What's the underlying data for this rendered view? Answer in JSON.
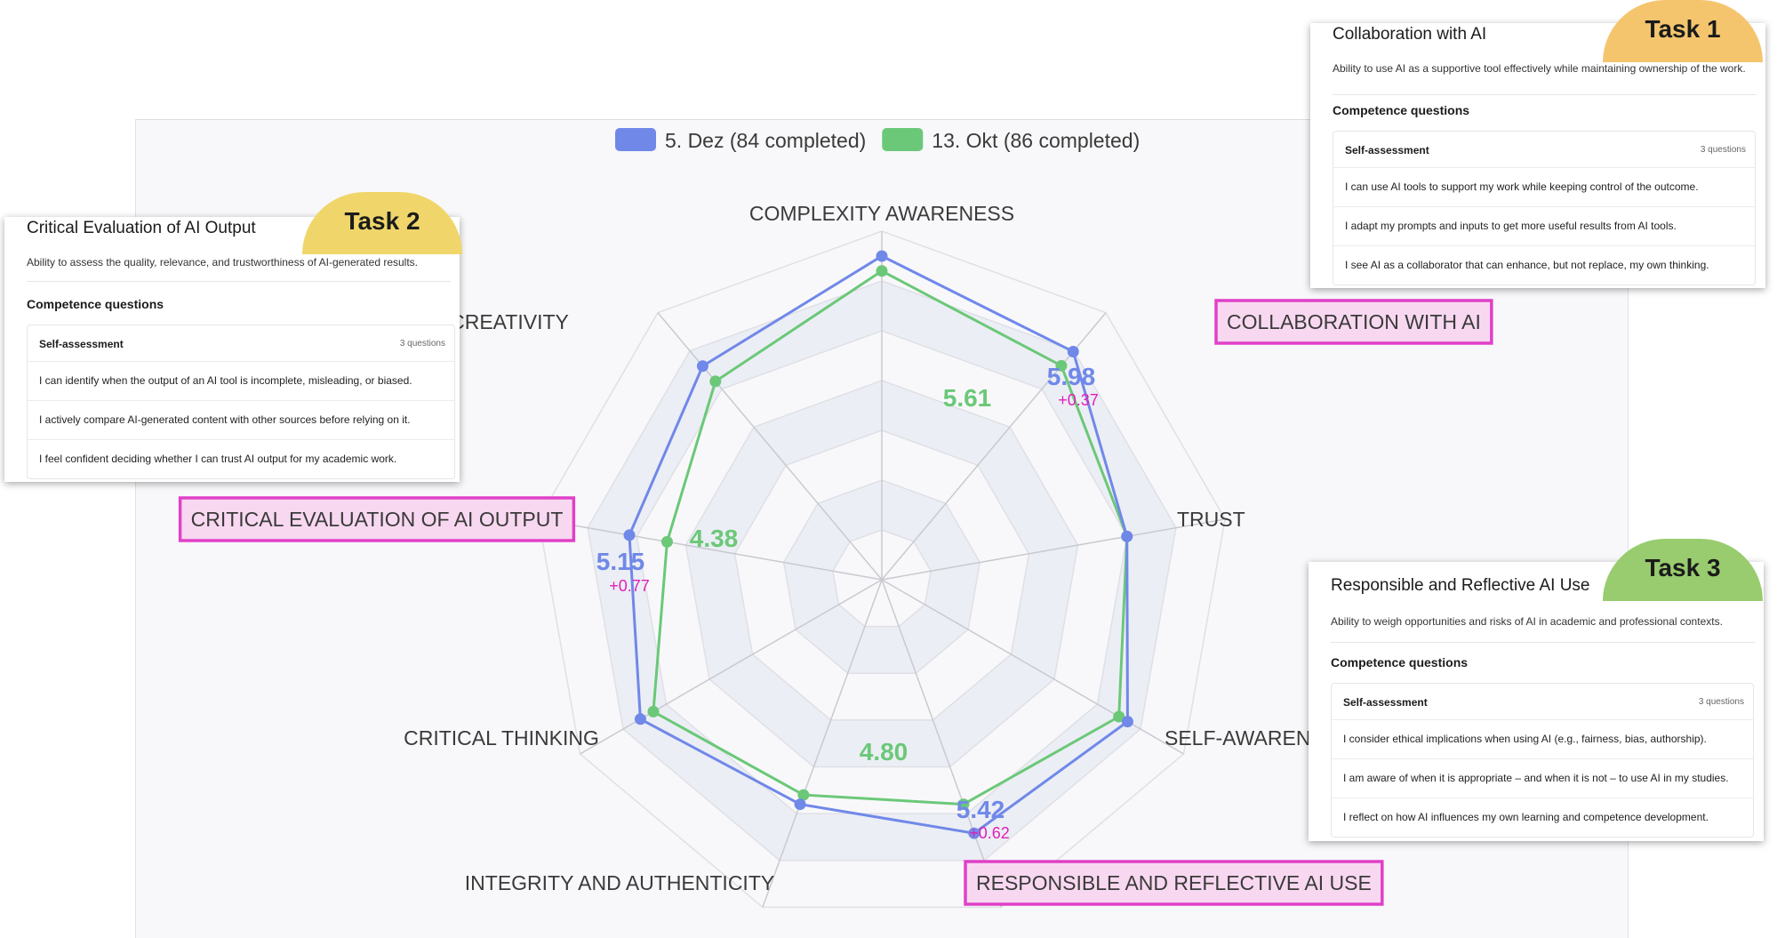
{
  "chart_data": {
    "type": "radar",
    "axes": [
      "COMPLEXITY AWARENESS",
      "COLLABORATION WITH AI",
      "TRUST",
      "SELF-AWARENESS",
      "RESPONSIBLE AND REFLECTIVE AI USE",
      "INTEGRITY AND AUTHENTICITY",
      "CRITICAL THINKING",
      "CRITICAL EVALUATION OF AI OUTPUT",
      "CREATIVITY"
    ],
    "axis_labels_displayed": [
      "COMPLEXITY AWARENESS",
      "COLLABORATION WITH AI",
      "TRUST",
      "SELF-AWARENE",
      "RESPONSIBLE AND REFLECTIVE AI USE",
      "INTEGRITY AND AUTHENTICITY",
      "CRITICAL THINKING",
      "CRITICAL EVALUATION OF AI OUTPUT",
      "CREATIVITY"
    ],
    "rlim": [
      0,
      7
    ],
    "series": [
      {
        "name": "5. Dez (84 completed)",
        "color": "#7088e8",
        "values": [
          6.5,
          5.98,
          5.0,
          5.7,
          5.42,
          4.8,
          5.6,
          5.15,
          5.6
        ]
      },
      {
        "name": "13. Okt (86 completed)",
        "color": "#6bc878",
        "values": [
          6.2,
          5.61,
          5.0,
          5.5,
          4.8,
          4.6,
          5.3,
          4.38,
          5.2
        ]
      }
    ],
    "highlighted": [
      {
        "axis": "COLLABORATION WITH AI",
        "new_label": "5.98",
        "old_label": "5.61",
        "delta": "+0.37"
      },
      {
        "axis": "CRITICAL EVALUATION OF AI OUTPUT",
        "new_label": "5.15",
        "old_label": "4.38",
        "delta": "+0.77"
      },
      {
        "axis": "RESPONSIBLE AND REFLECTIVE AI USE",
        "new_label": "5.42",
        "old_label": "4.80",
        "delta": "+0.62"
      }
    ],
    "legend_position": "top-center",
    "grid": true
  },
  "colors": {
    "new_series": "#7088e8",
    "old_series": "#6bc878",
    "highlight_border": "#e040c8",
    "highlight_fill": "#f8d8f0",
    "delta_text": "#e020b8",
    "task1": "#f5c56e",
    "task2": "#f0d66a",
    "task3": "#98cc6e"
  },
  "legend": [
    {
      "label": "5. Dez (84 completed)"
    },
    {
      "label": "13. Okt (86 completed)"
    }
  ],
  "cards": {
    "task1": {
      "badge": "Task 1",
      "title": "Collaboration with AI",
      "description": "Ability to use AI as a supportive tool effectively while maintaining ownership of the work.",
      "section": "Competence questions",
      "group_label": "Self-assessment",
      "group_count": "3 questions",
      "questions": [
        "I can use AI tools to support my work while keeping control of the outcome.",
        "I adapt my prompts and inputs to get more useful results from AI tools.",
        "I see AI as a collaborator that can enhance, but not replace, my own thinking."
      ]
    },
    "task2": {
      "badge": "Task 2",
      "title": "Critical Evaluation of AI Output",
      "description": "Ability to assess the quality, relevance, and trustworthiness of AI-generated results.",
      "section": "Competence questions",
      "group_label": "Self-assessment",
      "group_count": "3 questions",
      "questions": [
        "I can identify when the output of an AI tool is incomplete, misleading, or biased.",
        "I actively compare AI-generated content with other sources before relying on it.",
        "I feel confident deciding whether I can trust AI output for my academic work."
      ]
    },
    "task3": {
      "badge": "Task 3",
      "title": "Responsible and Reflective AI Use",
      "description": "Ability to weigh opportunities and risks of AI in academic and professional contexts.",
      "section": "Competence questions",
      "group_label": "Self-assessment",
      "group_count": "3 questions",
      "questions": [
        "I consider ethical implications when using AI (e.g., fairness, bias, authorship).",
        "I am aware of when it is appropriate – and when it is not – to use AI in my studies.",
        "I reflect on how AI influences my own learning and competence development."
      ]
    }
  }
}
